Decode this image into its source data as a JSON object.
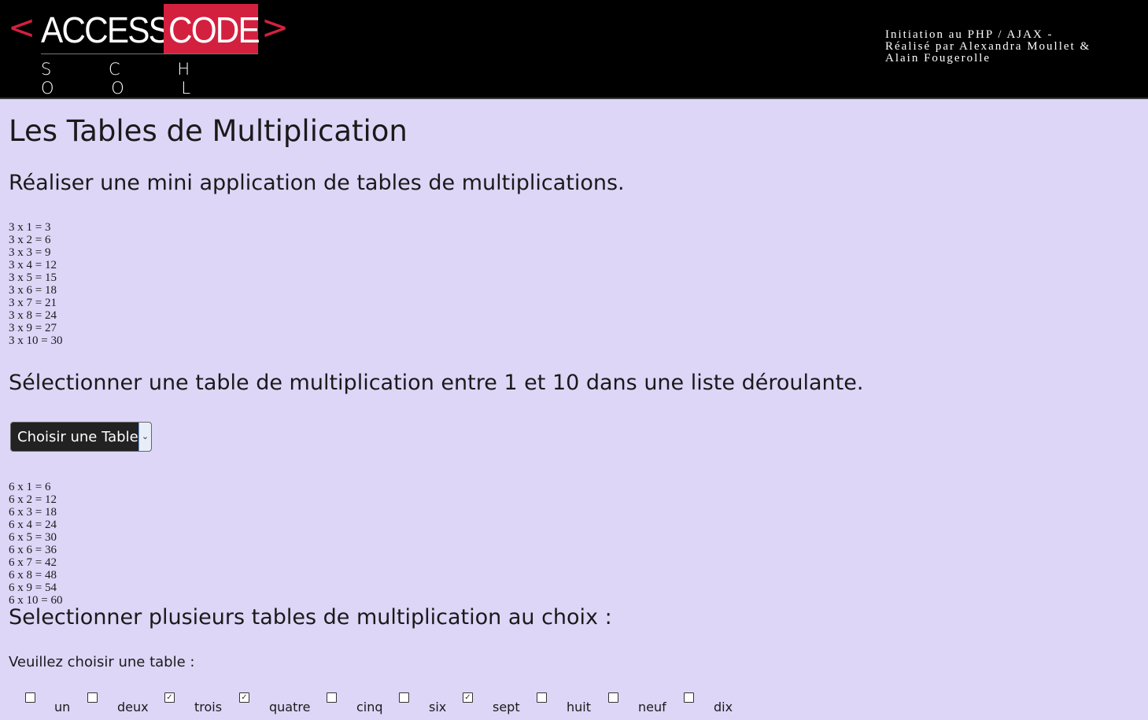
{
  "header": {
    "logo": {
      "left_chevron": "<",
      "word1": "ACCESS",
      "word2": "CODE",
      "right_chevron": ">",
      "subtitle": "S C H O O L"
    },
    "credits": [
      "Initiation au PHP / AJAX -",
      "Réalisé par Alexandra Moullet &",
      "Alain Fougerolle"
    ]
  },
  "main": {
    "title": "Les Tables de Multiplication",
    "section1": {
      "heading": "Réaliser une mini application de tables de multiplications.",
      "lines": [
        "3 x 1 = 3",
        "3 x 2 = 6",
        "3 x 3 = 9",
        "3 x 4 = 12",
        "3 x 5 = 15",
        "3 x 6 = 18",
        "3 x 7 = 21",
        "3 x 8 = 24",
        "3 x 9 = 27",
        "3 x 10 = 30"
      ]
    },
    "section2": {
      "heading": "Sélectionner une table de multiplication entre 1 et 10 dans une liste déroulante.",
      "select_value": "Choisir une Table",
      "lines": [
        "6 x 1 = 6",
        "6 x 2 = 12",
        "6 x 3 = 18",
        "6 x 4 = 24",
        "6 x 5 = 30",
        "6 x 6 = 36",
        "6 x 7 = 42",
        "6 x 8 = 48",
        "6 x 9 = 54",
        "6 x 10 = 60"
      ]
    },
    "section3": {
      "heading": "Selectionner plusieurs tables de multiplication au choix :",
      "prompt": "Veuillez choisir une table :",
      "checkboxes": [
        {
          "label": "un",
          "checked": false
        },
        {
          "label": "deux",
          "checked": false
        },
        {
          "label": "trois",
          "checked": true
        },
        {
          "label": "quatre",
          "checked": true
        },
        {
          "label": "cinq",
          "checked": false
        },
        {
          "label": "six",
          "checked": false
        },
        {
          "label": "sept",
          "checked": true
        },
        {
          "label": "huit",
          "checked": false
        },
        {
          "label": "neuf",
          "checked": false
        },
        {
          "label": "dix",
          "checked": false
        }
      ]
    }
  },
  "colors": {
    "background": "#ddd6f7",
    "header": "#000000",
    "brand_red": "#d4203f"
  }
}
